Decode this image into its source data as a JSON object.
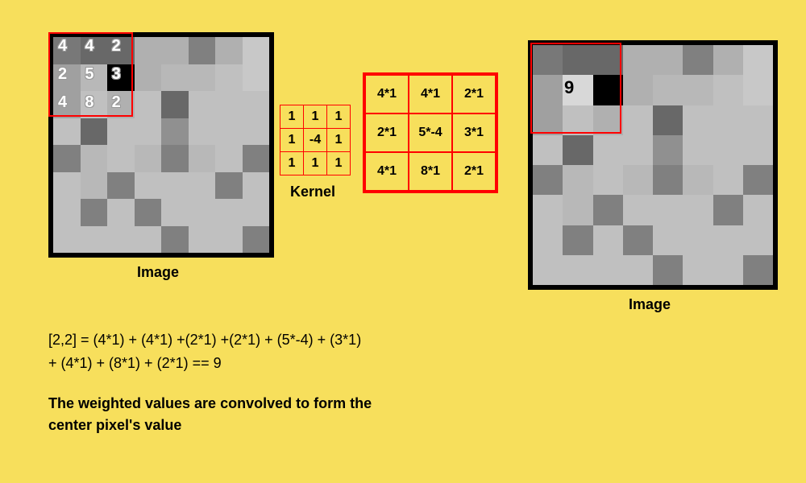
{
  "source_grid": [
    "#787878",
    "#686868",
    "#686868",
    "#b0b0b0",
    "#b0b0b0",
    "#808080",
    "#b0b0b0",
    "#c8c8c8",
    "#a0a0a0",
    "#b8b8b8",
    "#000000",
    "#b0b0b0",
    "#b8b8b8",
    "#b8b8b8",
    "#c0c0c0",
    "#c8c8c8",
    "#a0a0a0",
    "#c0c0c0",
    "#b0b0b0",
    "#c0c0c0",
    "#686868",
    "#c0c0c0",
    "#c0c0c0",
    "#c0c0c0",
    "#c0c0c0",
    "#686868",
    "#c0c0c0",
    "#c0c0c0",
    "#909090",
    "#c0c0c0",
    "#c0c0c0",
    "#c0c0c0",
    "#808080",
    "#b8b8b8",
    "#c0c0c0",
    "#b8b8b8",
    "#808080",
    "#b8b8b8",
    "#c0c0c0",
    "#808080",
    "#c0c0c0",
    "#b8b8b8",
    "#808080",
    "#c0c0c0",
    "#c0c0c0",
    "#c0c0c0",
    "#808080",
    "#c0c0c0",
    "#c0c0c0",
    "#808080",
    "#c0c0c0",
    "#808080",
    "#c0c0c0",
    "#c0c0c0",
    "#c0c0c0",
    "#c0c0c0",
    "#c0c0c0",
    "#c0c0c0",
    "#c0c0c0",
    "#c0c0c0",
    "#808080",
    "#c0c0c0",
    "#c0c0c0",
    "#808080"
  ],
  "result_grid": [
    "#787878",
    "#686868",
    "#686868",
    "#b0b0b0",
    "#b0b0b0",
    "#808080",
    "#b0b0b0",
    "#c8c8c8",
    "#a0a0a0",
    "#d8d8d8",
    "#000000",
    "#b0b0b0",
    "#b8b8b8",
    "#b8b8b8",
    "#c0c0c0",
    "#c8c8c8",
    "#a0a0a0",
    "#c0c0c0",
    "#b0b0b0",
    "#c0c0c0",
    "#686868",
    "#c0c0c0",
    "#c0c0c0",
    "#c0c0c0",
    "#c0c0c0",
    "#686868",
    "#c0c0c0",
    "#c0c0c0",
    "#909090",
    "#c0c0c0",
    "#c0c0c0",
    "#c0c0c0",
    "#808080",
    "#b8b8b8",
    "#c0c0c0",
    "#b8b8b8",
    "#808080",
    "#b8b8b8",
    "#c0c0c0",
    "#808080",
    "#c0c0c0",
    "#b8b8b8",
    "#808080",
    "#c0c0c0",
    "#c0c0c0",
    "#c0c0c0",
    "#808080",
    "#c0c0c0",
    "#c0c0c0",
    "#808080",
    "#c0c0c0",
    "#808080",
    "#c0c0c0",
    "#c0c0c0",
    "#c0c0c0",
    "#c0c0c0",
    "#c0c0c0",
    "#c0c0c0",
    "#c0c0c0",
    "#c0c0c0",
    "#808080",
    "#c0c0c0",
    "#c0c0c0",
    "#808080"
  ],
  "source_window_values": [
    "4",
    "4",
    "2",
    "2",
    "5",
    "3",
    "4",
    "8",
    "2"
  ],
  "kernel_values": [
    "1",
    "1",
    "1",
    "1",
    "-4",
    "1",
    "1",
    "1",
    "1"
  ],
  "multiply_values": [
    "4*1",
    "4*1",
    "2*1",
    "2*1",
    "5*-4",
    "3*1",
    "4*1",
    "8*1",
    "2*1"
  ],
  "result_center_value": "9",
  "labels": {
    "source_image": "Image",
    "result_image": "Image",
    "kernel": "Kernel"
  },
  "formula_line1": "[2,2] = (4*1) + (4*1) +(2*1) +(2*1) + (5*-4) + (3*1)",
  "formula_line2": "+ (4*1) + (8*1) + (2*1) == 9",
  "explanation_line1": "The weighted values are convolved to form the",
  "explanation_line2": "center pixel's value",
  "chart_data": {
    "type": "table",
    "title": "Convolution kernel application",
    "input_window": [
      [
        4,
        4,
        2
      ],
      [
        2,
        5,
        3
      ],
      [
        4,
        8,
        2
      ]
    ],
    "kernel": [
      [
        1,
        1,
        1
      ],
      [
        1,
        -4,
        1
      ],
      [
        1,
        1,
        1
      ]
    ],
    "output_position": [
      2,
      2
    ],
    "output_value": 9
  }
}
